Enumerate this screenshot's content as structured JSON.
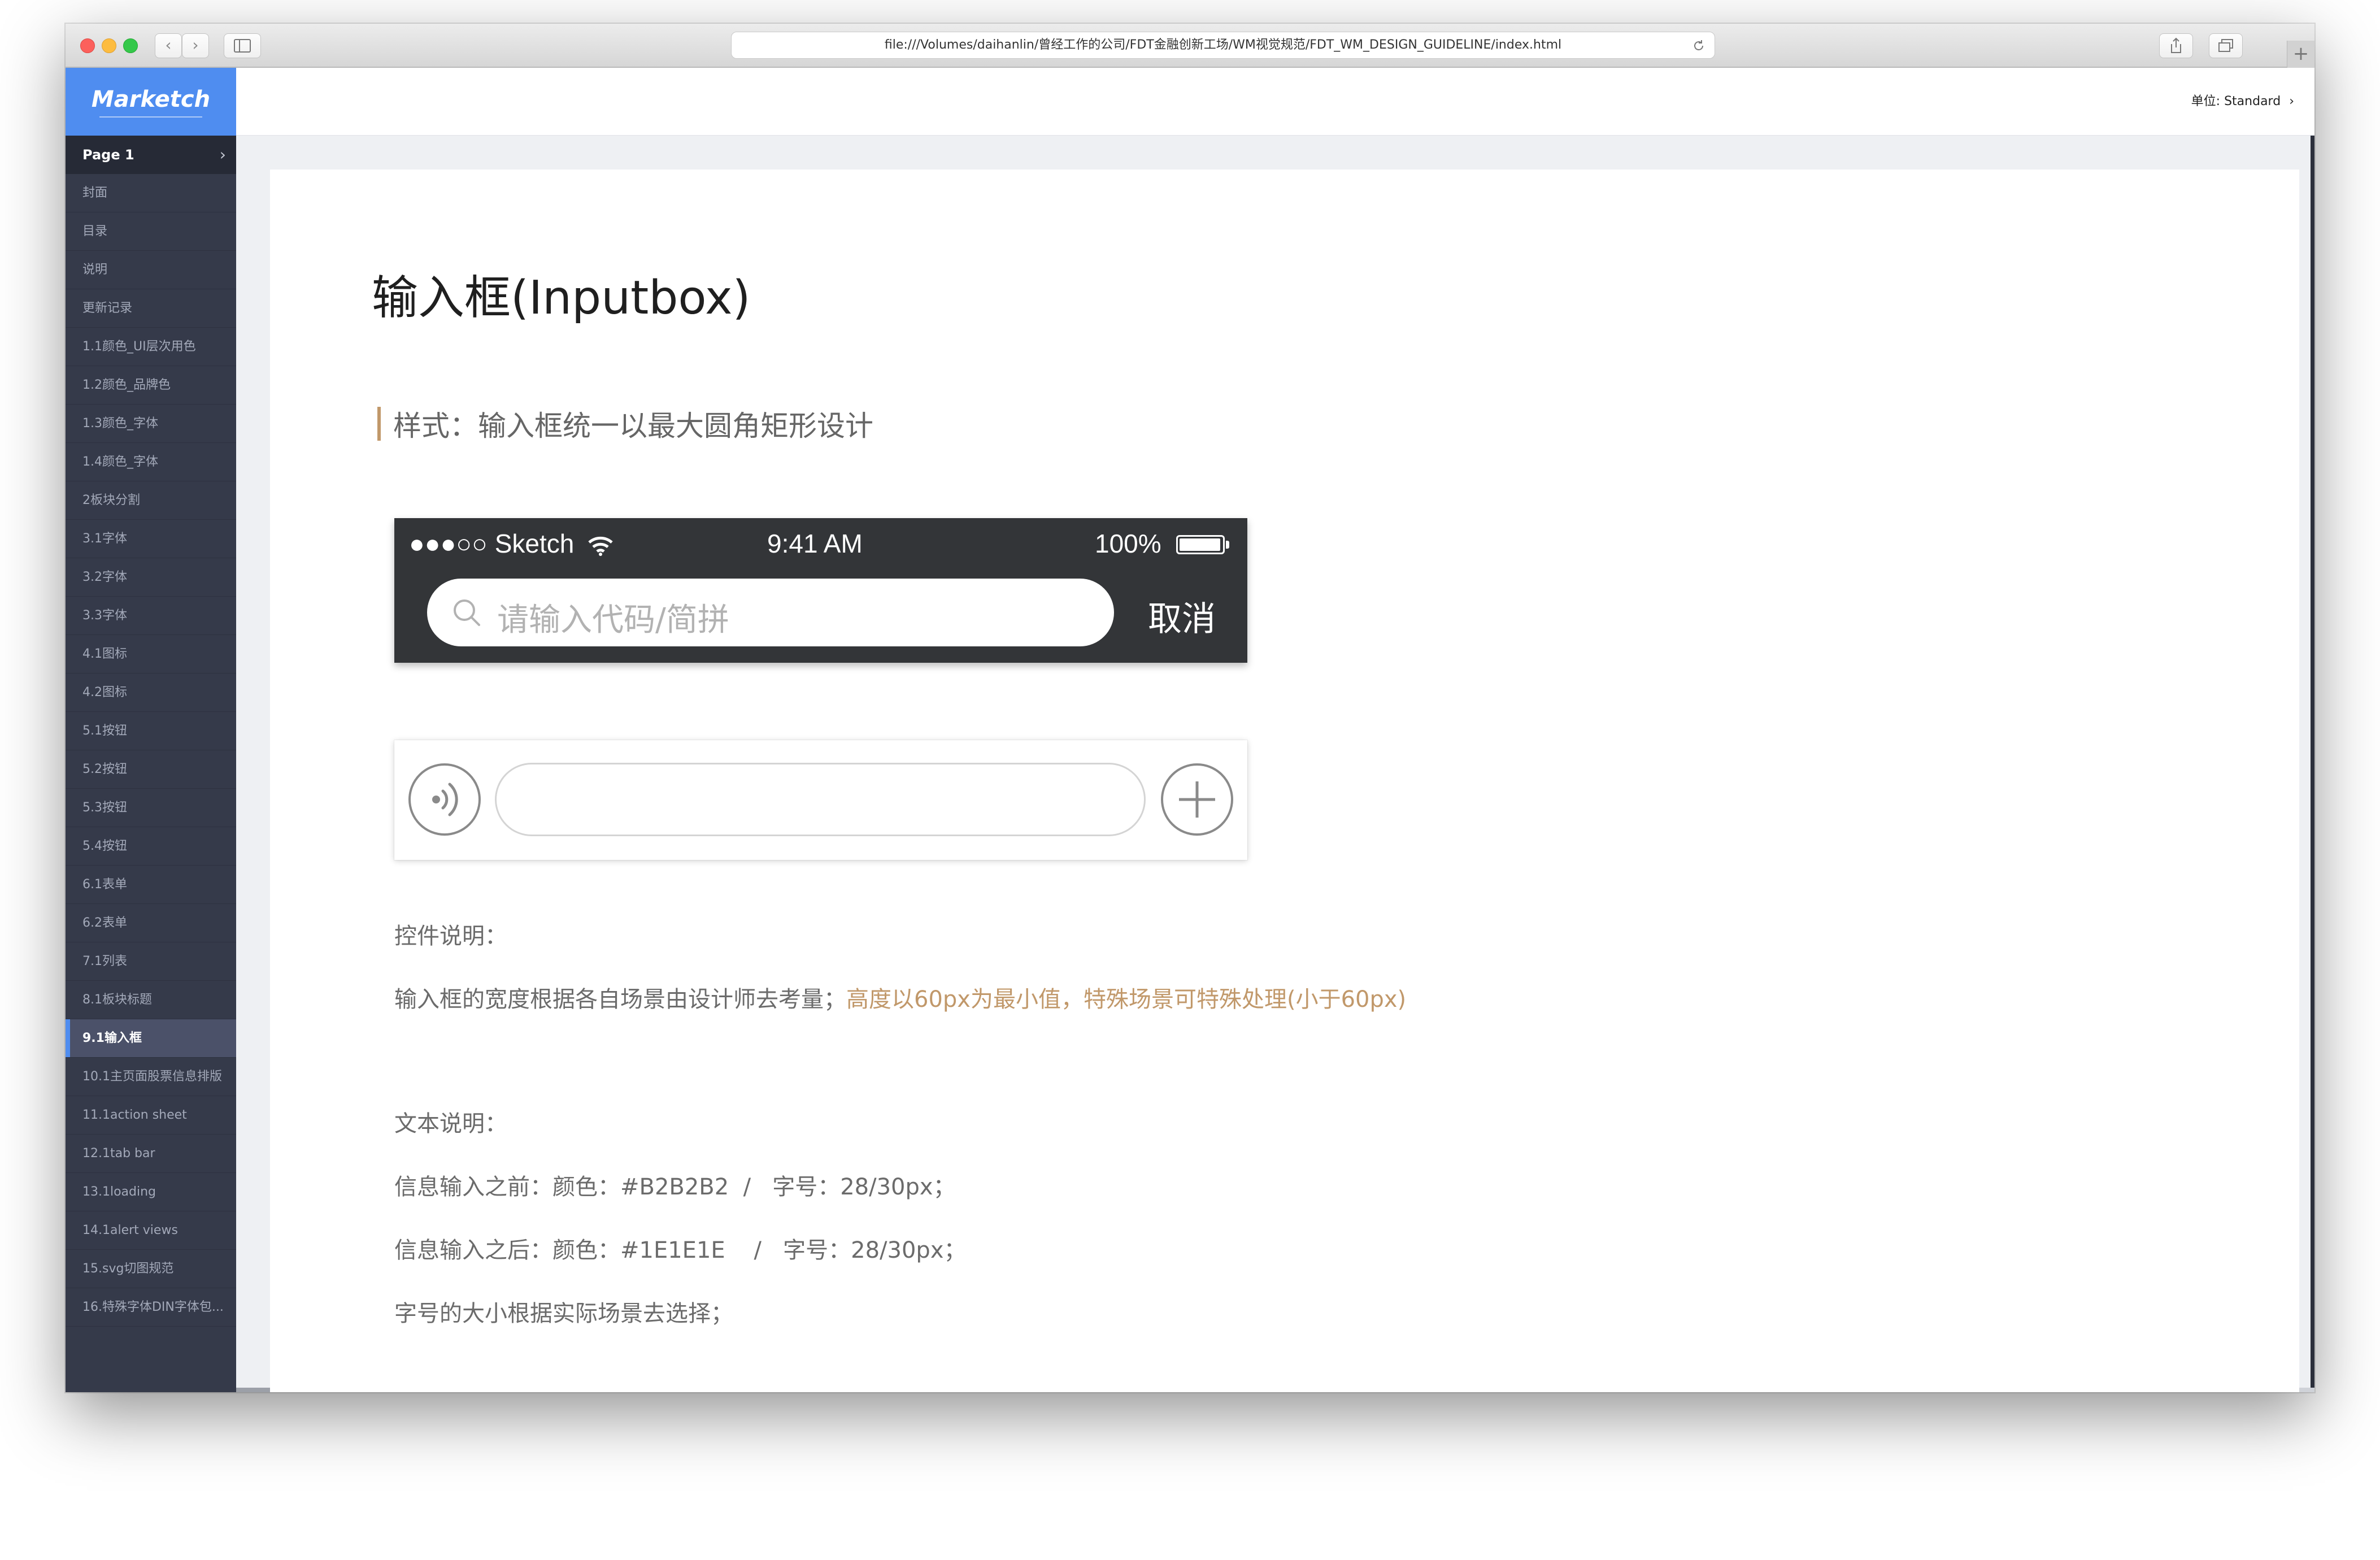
{
  "browser": {
    "address": "file:///Volumes/daihanlin/曾经工作的公司/FDT金融创新工场/WM视觉规范/FDT_WM_DESIGN_GUIDELINE/index.html",
    "new_tab": "+"
  },
  "sidebar": {
    "logo": "Marketch",
    "page_header": "Page 1",
    "items": [
      {
        "label": "封面"
      },
      {
        "label": "目录"
      },
      {
        "label": "说明"
      },
      {
        "label": "更新记录"
      },
      {
        "label": "1.1颜色_UI层次用色"
      },
      {
        "label": "1.2颜色_品牌色"
      },
      {
        "label": "1.3颜色_字体"
      },
      {
        "label": "1.4颜色_字体"
      },
      {
        "label": "2板块分割"
      },
      {
        "label": "3.1字体"
      },
      {
        "label": "3.2字体"
      },
      {
        "label": "3.3字体"
      },
      {
        "label": "4.1图标"
      },
      {
        "label": "4.2图标"
      },
      {
        "label": "5.1按钮"
      },
      {
        "label": "5.2按钮"
      },
      {
        "label": "5.3按钮"
      },
      {
        "label": "5.4按钮"
      },
      {
        "label": "6.1表单"
      },
      {
        "label": "6.2表单"
      },
      {
        "label": "7.1列表"
      },
      {
        "label": "8.1板块标题"
      },
      {
        "label": "9.1输入框",
        "active": true
      },
      {
        "label": "10.1主页面股票信息排版"
      },
      {
        "label": "11.1action sheet"
      },
      {
        "label": "12.1tab bar"
      },
      {
        "label": "13.1loading"
      },
      {
        "label": "14.1alert views"
      },
      {
        "label": "15.svg切图规范"
      },
      {
        "label": "16.特殊字体DIN字体包..."
      }
    ]
  },
  "topbar": {
    "unit_label": "单位:",
    "unit_value": "Standard"
  },
  "main": {
    "title": "输入框(Inputbox)",
    "subtitle": "样式：输入框统一以最大圆角矩形设计",
    "mock_search": {
      "carrier": "●●●○○ Sketch",
      "time": "9:41 AM",
      "battery_text": "100%",
      "battery_level": 1.0,
      "placeholder": "请输入代码/简拼",
      "cancel": "取消"
    },
    "control_heading": "控件说明：",
    "control_desc": "输入框的宽度根据各自场景由设计师去考量；",
    "control_desc_highlight": "高度以60px为最小值，特殊场景可特殊处理(小于60px)",
    "text_heading": "文本说明：",
    "text_before": "信息输入之前：颜色：#B2B2B2  /   字号：28/30px；",
    "text_after": "信息输入之后：颜色：#1E1E1E    /   字号：28/30px；",
    "text_size_note": "字号的大小根据实际场景去选择；"
  },
  "colors": {
    "accent": "#4f8df0",
    "sidebar_bg": "#353a4a",
    "highlight": "#c1986a",
    "placeholder": "#B2B2B2",
    "filled_text": "#1E1E1E"
  }
}
